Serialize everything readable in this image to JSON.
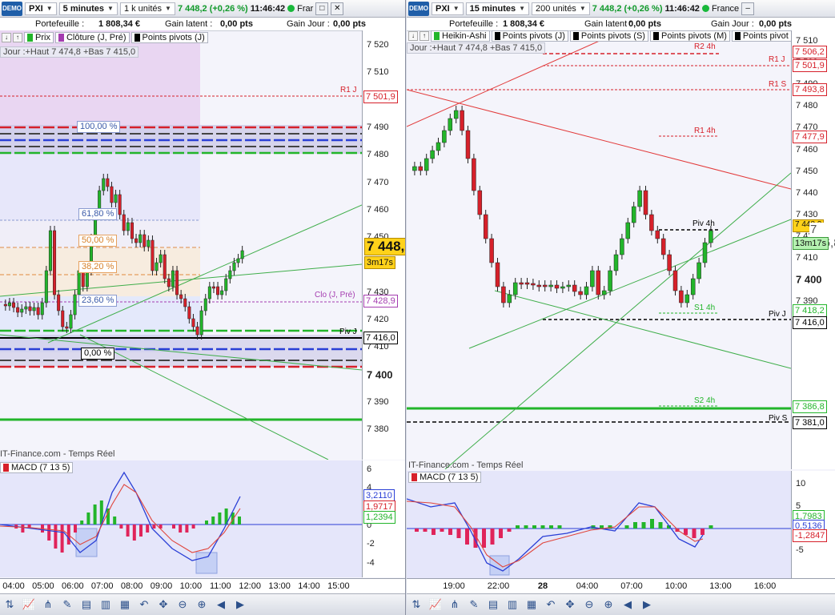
{
  "left": {
    "logo": "DEMO",
    "instrument": "PXI",
    "timeframe": "5 minutes",
    "units": "1 k unités",
    "last_price": "7 448,2 (+0,26 %)",
    "clock": "11:46:42",
    "market": "Frar",
    "account": {
      "portefeuille_label": "Portefeuille :",
      "portefeuille_value": "1 808,34 €",
      "latent_label": "Gain latent :",
      "latent_value": "0,00 pts",
      "jour_label": "Gain Jour :",
      "jour_value": "0,00 pts"
    },
    "legend": {
      "prix": "Prix",
      "cloture": "Clôture (J, Pré)",
      "pivots": "Points pivots (J)"
    },
    "infobar": "Jour :+Haut 7 474,8 +Bas 7 415,0",
    "fib": {
      "f100": "100,00 %",
      "f618": "61,80 %",
      "f50": "50,00 %",
      "f382": "38,20 %",
      "f236": "23,60 %",
      "f0": "0,00 %"
    },
    "levels": {
      "r1": "R1 J",
      "clo": "Clo (J, Pré)",
      "pivj": "Piv J"
    },
    "yaxis": [
      "7 520",
      "7 510",
      "7 500",
      "7 490",
      "7 480",
      "7 470",
      "7 460",
      "7 450",
      "7 440",
      "7 430",
      "7 420",
      "7 410",
      "7 400",
      "7 390",
      "7 380"
    ],
    "ytags": {
      "r1": "7 501,9",
      "clo": "7 428,9",
      "piv": "7 416,0",
      "price": "7 448,2",
      "timer": "3m17s"
    },
    "source": "IT-Finance.com - Temps Réel",
    "macd_label": "MACD (7 13 5)",
    "macd_axis": [
      "6",
      "4",
      "2",
      "0",
      "-2",
      "-4"
    ],
    "macd_tags": {
      "a": "3,2110",
      "b": "1,9717",
      "c": "1,2394"
    },
    "xaxis": [
      "04:00",
      "05:00",
      "06:00",
      "07:00",
      "08:00",
      "09:00",
      "10:00",
      "11:00",
      "12:00",
      "13:00",
      "14:00",
      "15:00"
    ],
    "colors": {
      "up": "#22b52a",
      "down": "#d6202a",
      "macd": "#2a3fd6",
      "signal": "#e0453c"
    }
  },
  "right": {
    "logo": "DEMO",
    "instrument": "PXI",
    "timeframe": "15 minutes",
    "units": "200 unités",
    "last_price": "7 448,2 (+0,26 %)",
    "clock": "11:46:42",
    "market": "France",
    "account": {
      "portefeuille_label": "Portefeuille :",
      "portefeuille_value": "1 808,34 €",
      "latent_label": "Gain latent :",
      "latent_value": "0,00 pts",
      "jour_label": "Gain Jour :",
      "jour_value": "0,00 pts"
    },
    "legend": {
      "ha": "Heikin-Ashi",
      "pj": "Points pivots (J)",
      "ps": "Points pivots (S)",
      "pm": "Points pivots (M)",
      "pb": "Points pivot"
    },
    "infobar": "Jour :+Haut 7 474,8 +Bas 7 415,0",
    "levels": {
      "r2h": "R2 4h",
      "r1j": "R1 J",
      "r1s": "R1 S",
      "r1h": "R1 4h",
      "piv4h": "Piv 4h",
      "s14h": "S1 4h",
      "pivj": "Piv J",
      "s24h": "S2 4h",
      "pivs": "Piv S"
    },
    "yaxis": [
      "7 510",
      "7 500",
      "7 490",
      "7 480",
      "7 470",
      "7 460",
      "7 450",
      "7 440",
      "7 430",
      "7 420",
      "7 410",
      "7 400",
      "7 390"
    ],
    "ytags": {
      "r2h": "7 506,2",
      "r1j": "7 501,9",
      "r1s": "7 493,8",
      "r1h": "7 477,9",
      "price": "7 448,2",
      "big": "7 446,8",
      "timer": "13m17s",
      "s14h": "7 418,2",
      "piv": "7 416,0",
      "s24h": "7 386,8",
      "pivs": "7 381,0"
    },
    "source": "IT-Finance.com - Temps Réel",
    "macd_label": "MACD (7 13 5)",
    "macd_axis": [
      "10",
      "5",
      "0",
      "-5"
    ],
    "macd_tags": {
      "a": "1,7983",
      "b": "0,5136",
      "c": "-1,2847"
    },
    "xaxis": [
      "19:00",
      "22:00",
      "28",
      "04:00",
      "07:00",
      "10:00",
      "13:00",
      "16:00"
    ]
  }
}
